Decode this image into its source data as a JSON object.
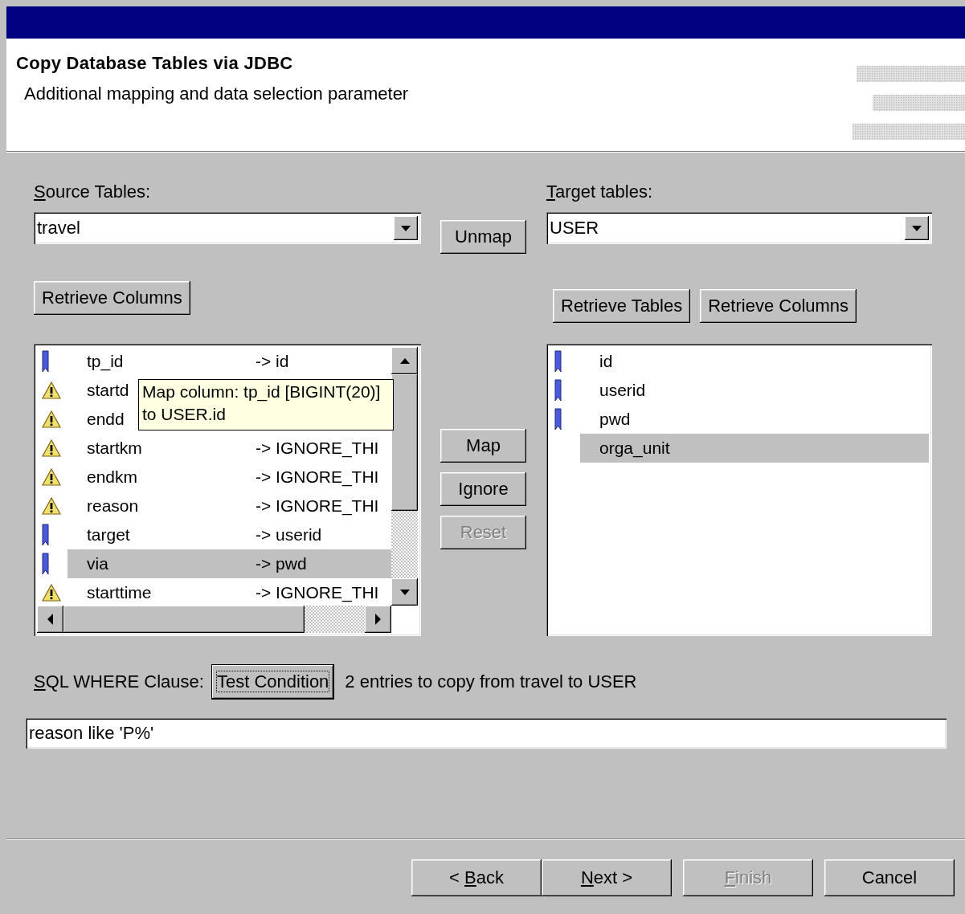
{
  "header": {
    "title": "Copy Database Tables via JDBC",
    "subtitle": "Additional mapping and data selection parameter"
  },
  "source": {
    "label": [
      {
        "text": "S",
        "underlined": true
      },
      {
        "text": "ource Tables:",
        "underlined": false
      }
    ],
    "value": "travel",
    "retrieve_button": "Retrieve Columns"
  },
  "unmap_button": "Unmap",
  "target": {
    "label": [
      {
        "text": "T",
        "underlined": true
      },
      {
        "text": "arget tables:",
        "underlined": false
      }
    ],
    "value": "USER",
    "buttons": [
      "Retrieve Tables",
      "Retrieve Columns"
    ]
  },
  "source_columns": [
    {
      "kind": "mapped",
      "name": "tp_id",
      "mapping": "-> id",
      "selected": false
    },
    {
      "kind": "ignored",
      "name": "startd",
      "selected": false
    },
    {
      "kind": "ignored",
      "name": "endd",
      "selected": false
    },
    {
      "kind": "ignored",
      "name": "startkm",
      "mapping": "-> IGNORE_THI",
      "selected": false
    },
    {
      "kind": "ignored",
      "name": "endkm",
      "mapping": "-> IGNORE_THI",
      "selected": false
    },
    {
      "kind": "ignored",
      "name": "reason",
      "mapping": "-> IGNORE_THI",
      "selected": false
    },
    {
      "kind": "mapped",
      "name": "target",
      "mapping": "-> userid",
      "selected": false
    },
    {
      "kind": "mapped",
      "name": "via",
      "mapping": "-> pwd",
      "selected": true
    },
    {
      "kind": "ignored",
      "name": "starttime",
      "mapping": "-> IGNORE_THI",
      "selected": false
    }
  ],
  "tooltip": {
    "lines": [
      "Map column: tp_id [BIGINT(20)]",
      "to USER.id"
    ]
  },
  "middle_buttons": [
    {
      "label": "Map",
      "disabled": false
    },
    {
      "label": "Ignore",
      "disabled": false
    },
    {
      "label": "Reset",
      "disabled": true
    }
  ],
  "target_columns": [
    {
      "kind": "mapped",
      "name": "id",
      "selected": false
    },
    {
      "kind": "mapped",
      "name": "userid",
      "selected": false
    },
    {
      "kind": "mapped",
      "name": "pwd",
      "selected": false
    },
    {
      "kind": "plain",
      "name": "orga_unit",
      "selected": true
    }
  ],
  "where": {
    "label": [
      {
        "text": "S",
        "underlined": true
      },
      {
        "text": "QL WHERE Clause:",
        "underlined": false
      }
    ],
    "test_button": "Test Condition",
    "test_focused": true,
    "result": "2 entries to copy from travel to USER",
    "value": "reason like 'P%'"
  },
  "nav_buttons": [
    {
      "label": [
        {
          "text": "< ",
          "underlined": false
        },
        {
          "text": "B",
          "underlined": true
        },
        {
          "text": "ack",
          "underlined": false
        }
      ],
      "disabled": false
    },
    {
      "label": [
        {
          "text": "N",
          "underlined": true
        },
        {
          "text": "ext >",
          "underlined": false
        }
      ],
      "disabled": false
    },
    {
      "label": [
        {
          "text": "F",
          "underlined": true
        },
        {
          "text": "inish",
          "underlined": false
        }
      ],
      "disabled": true
    },
    {
      "label": [
        {
          "text": "Cancel",
          "underlined": false
        }
      ],
      "disabled": false
    }
  ]
}
